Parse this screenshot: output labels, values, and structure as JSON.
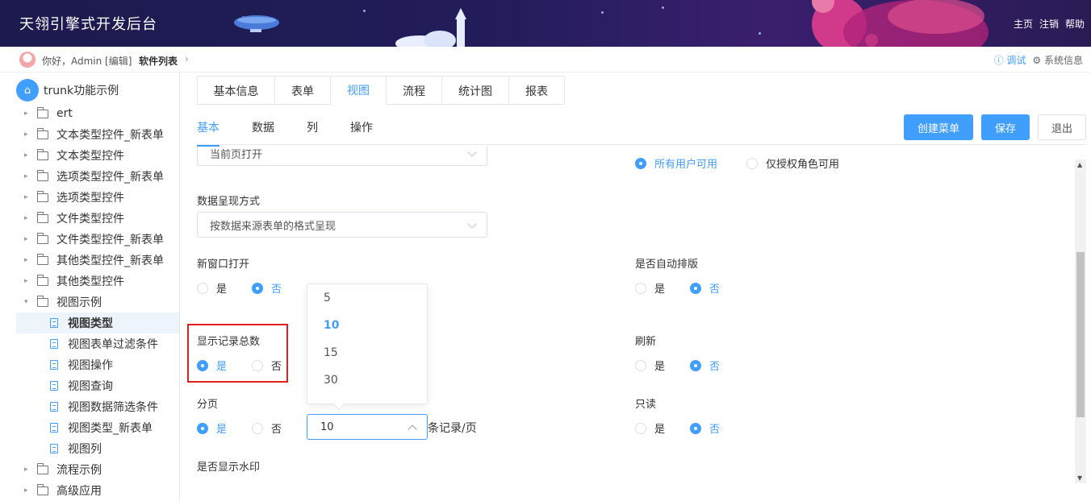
{
  "header": {
    "title": "天翎引擎式开发后台",
    "nav": [
      "主页",
      "注销",
      "帮助"
    ]
  },
  "breadcrumb": {
    "greeting": "你好，Admin [编辑]",
    "current": "软件列表",
    "debug": "ⓘ 调试",
    "sysinfo": "⚙ 系统信息"
  },
  "sidebar": {
    "root": "trunk功能示例",
    "items": [
      {
        "label": "ert",
        "kind": "folder",
        "caret": "▸"
      },
      {
        "label": "文本类型控件_新表单",
        "kind": "folder",
        "caret": "▸"
      },
      {
        "label": "文本类型控件",
        "kind": "folder",
        "caret": "▸"
      },
      {
        "label": "选项类型控件_新表单",
        "kind": "folder",
        "caret": "▸"
      },
      {
        "label": "选项类型控件",
        "kind": "folder",
        "caret": "▸"
      },
      {
        "label": "文件类型控件",
        "kind": "folder",
        "caret": "▸"
      },
      {
        "label": "文件类型控件_新表单",
        "kind": "folder",
        "caret": "▸"
      },
      {
        "label": "其他类型控件_新表单",
        "kind": "folder",
        "caret": "▸"
      },
      {
        "label": "其他类型控件",
        "kind": "folder",
        "caret": "▸"
      },
      {
        "label": "视图示例",
        "kind": "folder-open",
        "caret": "▾"
      },
      {
        "label": "视图类型",
        "kind": "doc",
        "selected": true
      },
      {
        "label": "视图表单过滤条件",
        "kind": "doc"
      },
      {
        "label": "视图操作",
        "kind": "doc"
      },
      {
        "label": "视图查询",
        "kind": "doc"
      },
      {
        "label": "视图数据筛选条件",
        "kind": "doc"
      },
      {
        "label": "视图类型_新表单",
        "kind": "doc"
      },
      {
        "label": "视图列",
        "kind": "doc"
      },
      {
        "label": "流程示例",
        "kind": "folder",
        "caret": "▸"
      },
      {
        "label": "高级应用",
        "kind": "folder",
        "caret": "▸"
      }
    ]
  },
  "tabs": [
    "基本信息",
    "表单",
    "视图",
    "流程",
    "统计图",
    "报表"
  ],
  "active_tab": "视图",
  "subtabs": [
    "基本",
    "数据",
    "列",
    "操作"
  ],
  "active_subtab": "基本",
  "buttons": {
    "create_menu": "创建菜单",
    "save": "保存",
    "exit": "退出"
  },
  "form": {
    "open_mode_value": "当前页打开",
    "permission_opts": [
      "所有用户可用",
      "仅授权角色可用"
    ],
    "display_mode_label": "数据呈现方式",
    "display_mode_value": "按数据来源表单的格式呈现",
    "new_window_label": "新窗口打开",
    "auto_layout_label": "是否自动排版",
    "show_total_label": "显示记录总数",
    "refresh_label": "刷新",
    "paging_label": "分页",
    "readonly_label": "只读",
    "watermark_label": "是否显示水印",
    "yes": "是",
    "no": "否",
    "page_size_value": "10",
    "page_size_suffix": "条记录/页",
    "page_size_options": [
      "5",
      "10",
      "15",
      "30"
    ],
    "page_size_selected": "10"
  },
  "colors": {
    "accent": "#409eff",
    "highlight": "#e02020",
    "header_bg": "#1c1a4e"
  }
}
